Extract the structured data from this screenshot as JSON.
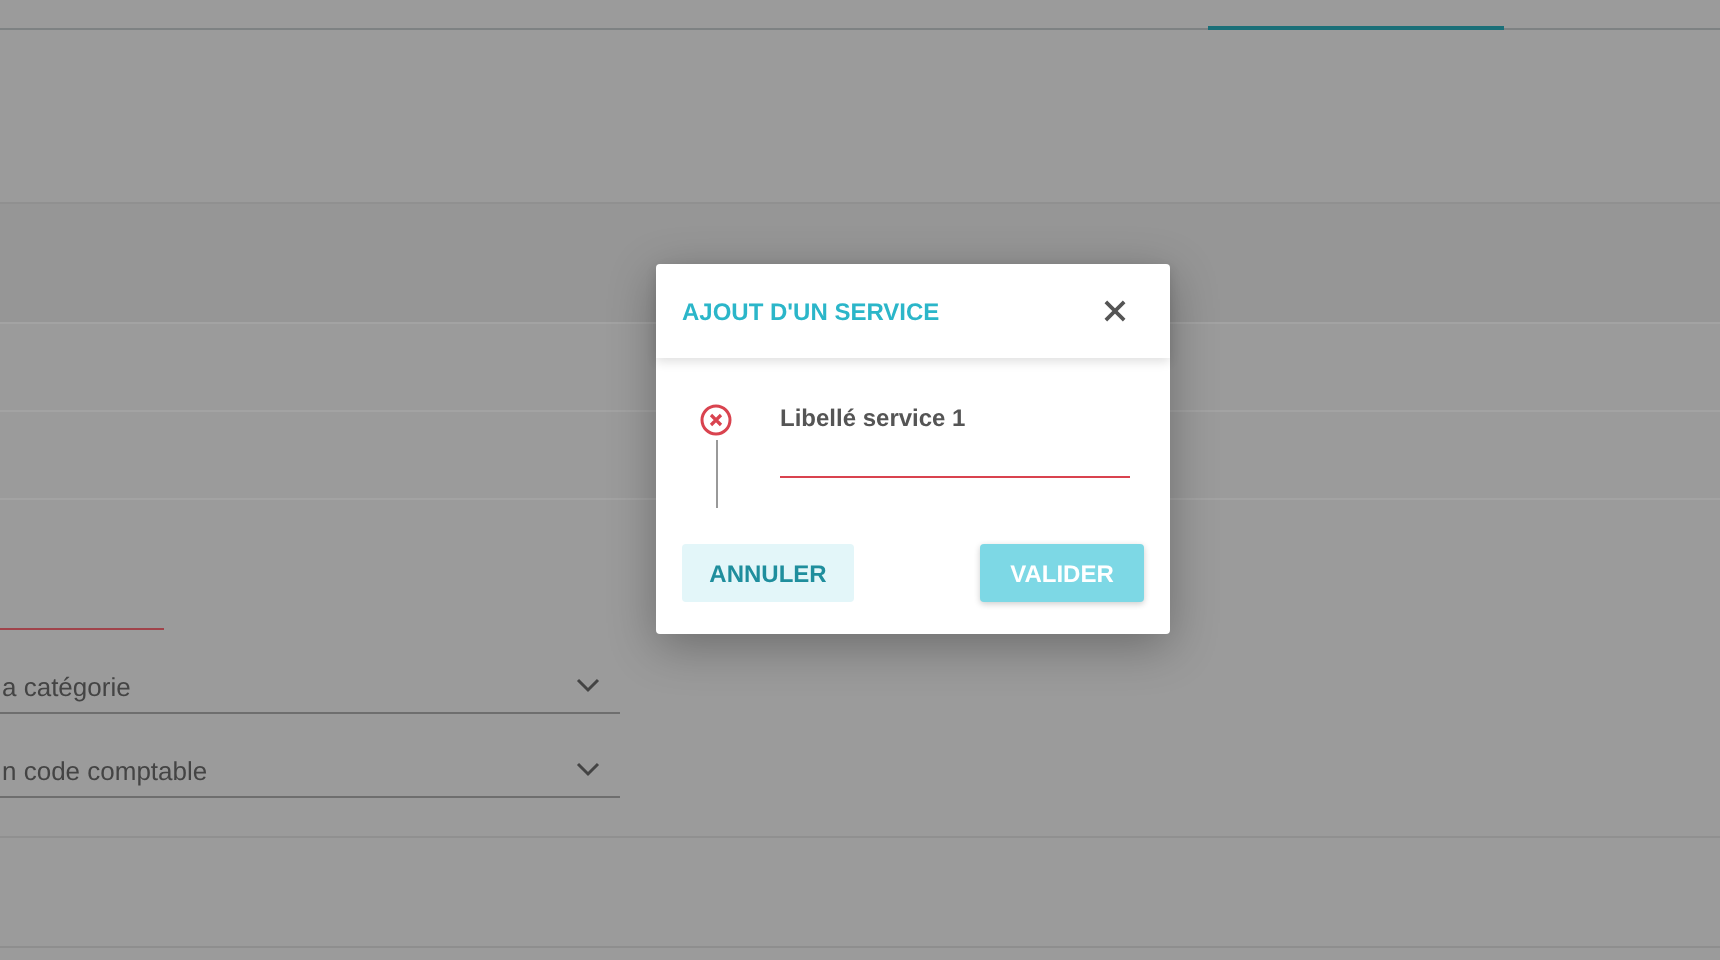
{
  "background_form": {
    "fields": [
      {
        "kind": "text",
        "invalid": true
      },
      {
        "kind": "select",
        "value": "a catégorie"
      },
      {
        "kind": "select",
        "value": "n code comptable"
      }
    ]
  },
  "dialog": {
    "title": "AJOUT D'UN SERVICE",
    "step": {
      "error": true,
      "label": "Libellé service 1"
    },
    "field": {
      "invalid": true
    },
    "buttons": [
      {
        "label": "ANNULER",
        "kind": "secondary"
      },
      {
        "label": "VALIDER",
        "kind": "primary"
      }
    ]
  }
}
